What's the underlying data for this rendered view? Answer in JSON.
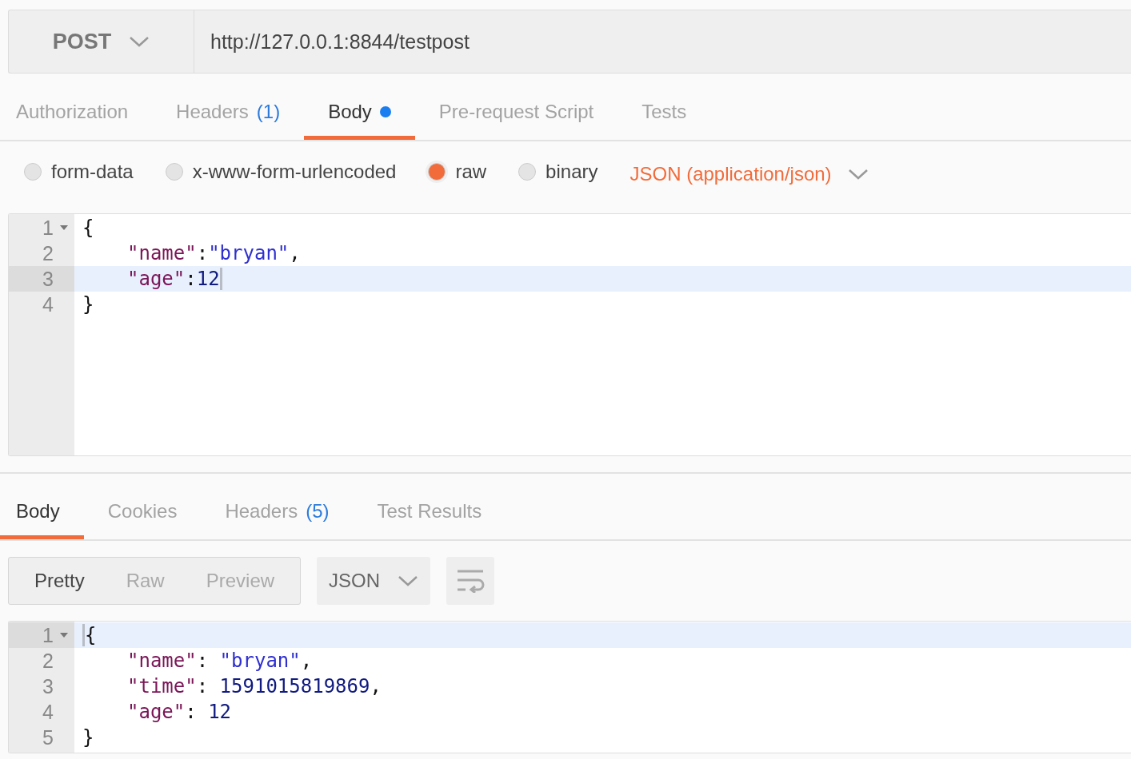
{
  "request": {
    "method": "POST",
    "url": "http://127.0.0.1:8844/testpost"
  },
  "request_tabs": [
    {
      "label": "Authorization",
      "selected": false,
      "modified": false
    },
    {
      "label": "Headers",
      "count": "(1)",
      "selected": false,
      "modified": false
    },
    {
      "label": "Body",
      "selected": true,
      "modified": true
    },
    {
      "label": "Pre-request Script",
      "selected": false,
      "modified": false
    },
    {
      "label": "Tests",
      "selected": false,
      "modified": false
    }
  ],
  "body_types": [
    {
      "label": "form-data",
      "selected": false
    },
    {
      "label": "x-www-form-urlencoded",
      "selected": false
    },
    {
      "label": "raw",
      "selected": true
    },
    {
      "label": "binary",
      "selected": false
    }
  ],
  "content_type": "JSON (application/json)",
  "request_body": {
    "lines": [
      {
        "number": "1",
        "foldable": true,
        "active": false,
        "indented": false,
        "cursor_before": false,
        "cursor_after": false,
        "tokens": [
          {
            "kind": "punct",
            "text": "{"
          }
        ]
      },
      {
        "number": "2",
        "foldable": false,
        "active": false,
        "indented": true,
        "cursor_before": false,
        "cursor_after": false,
        "tokens": [
          {
            "kind": "key",
            "text": "\"name\""
          },
          {
            "kind": "punct",
            "text": ":"
          },
          {
            "kind": "string",
            "text": "\"bryan\""
          },
          {
            "kind": "punct",
            "text": ","
          }
        ]
      },
      {
        "number": "3",
        "foldable": false,
        "active": true,
        "indented": true,
        "cursor_before": false,
        "cursor_after": true,
        "tokens": [
          {
            "kind": "key",
            "text": "\"age\""
          },
          {
            "kind": "punct",
            "text": ":"
          },
          {
            "kind": "number",
            "text": "12"
          }
        ]
      },
      {
        "number": "4",
        "foldable": false,
        "active": false,
        "indented": false,
        "cursor_before": false,
        "cursor_after": false,
        "tokens": [
          {
            "kind": "punct",
            "text": "}"
          }
        ]
      }
    ]
  },
  "response_tabs": [
    {
      "label": "Body",
      "selected": true
    },
    {
      "label": "Cookies",
      "selected": false
    },
    {
      "label": "Headers",
      "count": "(5)",
      "selected": false
    },
    {
      "label": "Test Results",
      "selected": false
    }
  ],
  "view_modes": [
    {
      "label": "Pretty",
      "selected": true
    },
    {
      "label": "Raw",
      "selected": false
    },
    {
      "label": "Preview",
      "selected": false
    }
  ],
  "format": "JSON",
  "response_body": {
    "lines": [
      {
        "number": "1",
        "foldable": true,
        "active": true,
        "indented": false,
        "cursor_before": true,
        "cursor_after": false,
        "tokens": [
          {
            "kind": "punct",
            "text": "{"
          }
        ]
      },
      {
        "number": "2",
        "foldable": false,
        "active": false,
        "indented": true,
        "cursor_before": false,
        "cursor_after": false,
        "tokens": [
          {
            "kind": "key",
            "text": "\"name\""
          },
          {
            "kind": "punct",
            "text": ": "
          },
          {
            "kind": "string",
            "text": "\"bryan\""
          },
          {
            "kind": "punct",
            "text": ","
          }
        ]
      },
      {
        "number": "3",
        "foldable": false,
        "active": false,
        "indented": true,
        "cursor_before": false,
        "cursor_after": false,
        "tokens": [
          {
            "kind": "key",
            "text": "\"time\""
          },
          {
            "kind": "punct",
            "text": ": "
          },
          {
            "kind": "number",
            "text": "1591015819869"
          },
          {
            "kind": "punct",
            "text": ","
          }
        ]
      },
      {
        "number": "4",
        "foldable": false,
        "active": false,
        "indented": true,
        "cursor_before": false,
        "cursor_after": false,
        "tokens": [
          {
            "kind": "key",
            "text": "\"age\""
          },
          {
            "kind": "punct",
            "text": ": "
          },
          {
            "kind": "number",
            "text": "12"
          }
        ]
      },
      {
        "number": "5",
        "foldable": false,
        "active": false,
        "indented": false,
        "cursor_before": false,
        "cursor_after": false,
        "tokens": [
          {
            "kind": "punct",
            "text": "}"
          }
        ]
      }
    ]
  }
}
